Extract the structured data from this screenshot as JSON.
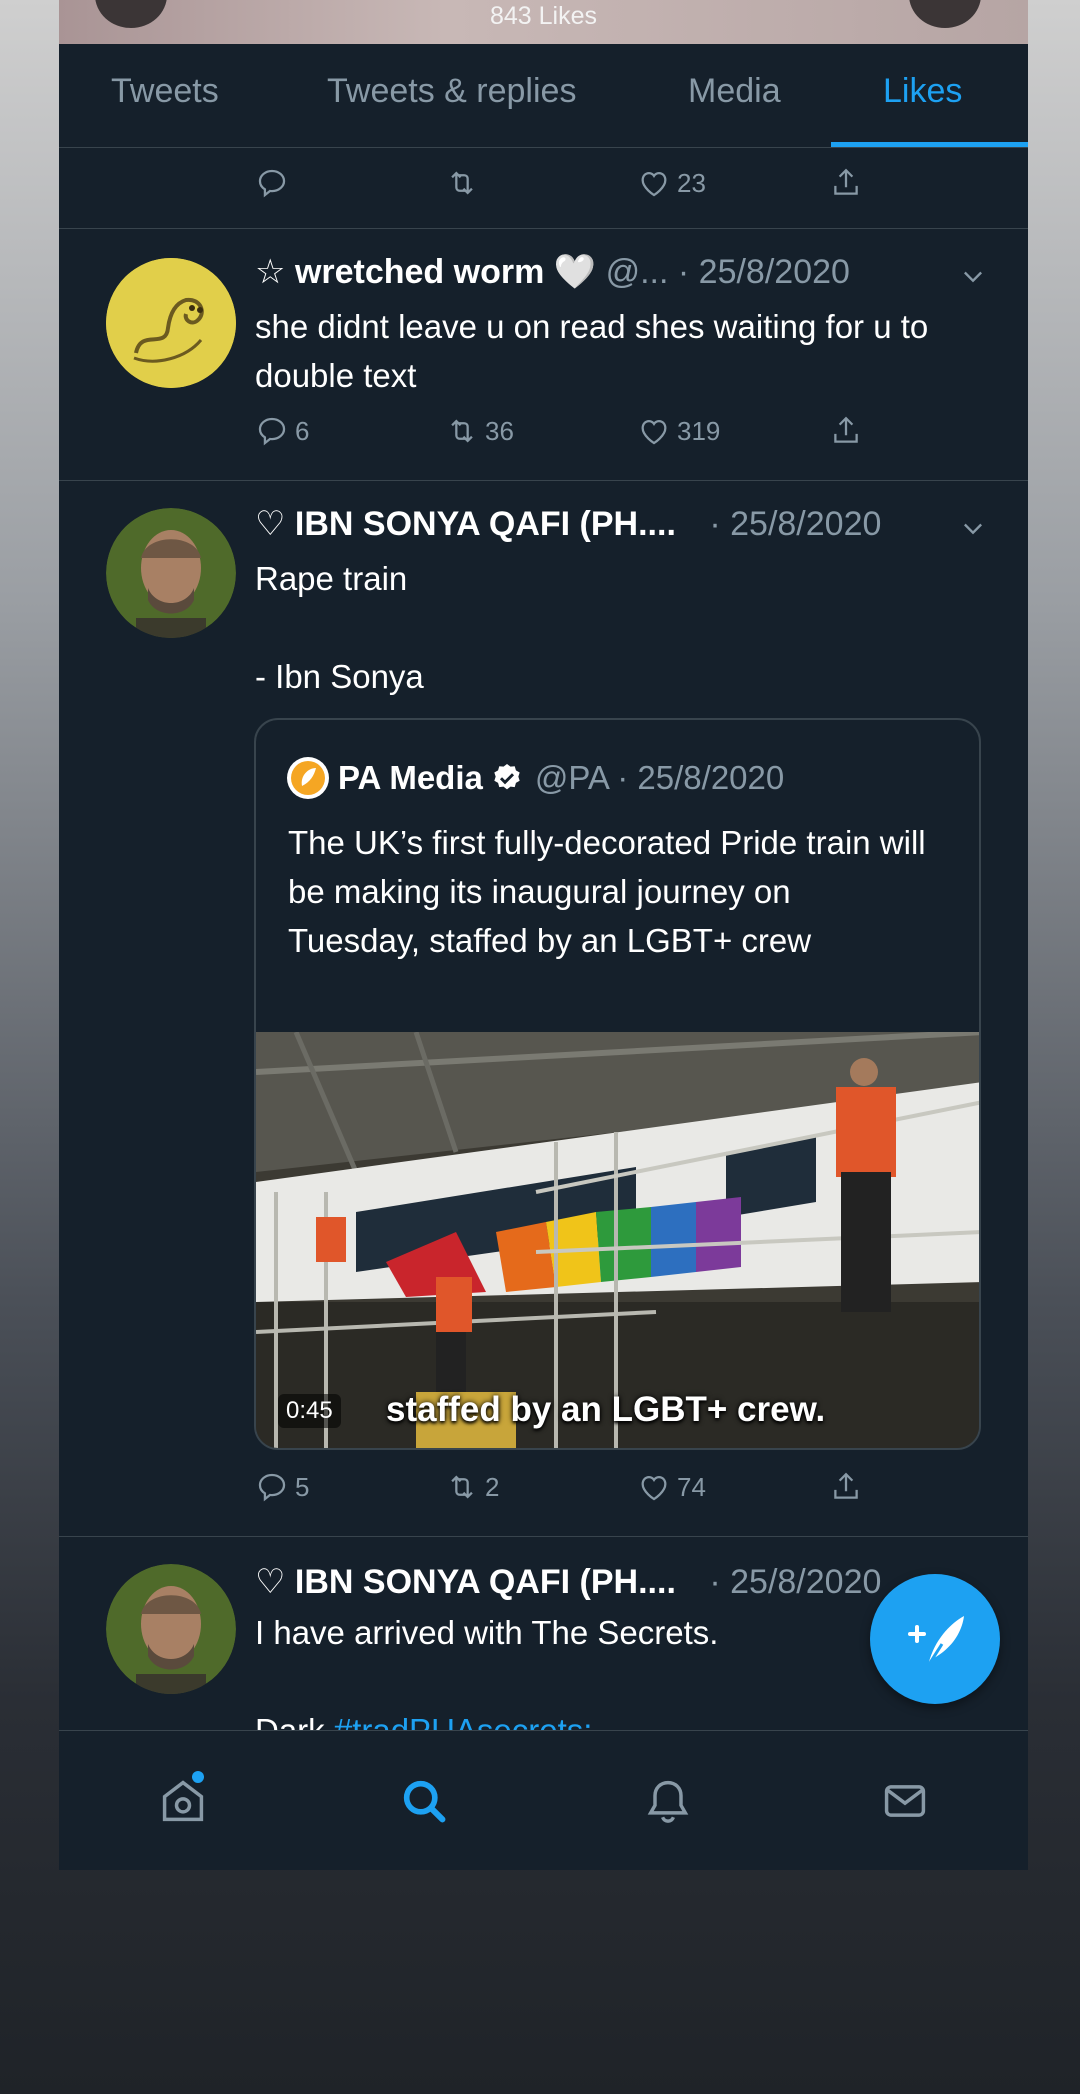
{
  "header": {
    "likes_count": "843 Likes"
  },
  "tabs": [
    {
      "label": "Tweets",
      "active": false
    },
    {
      "label": "Tweets & replies",
      "active": false
    },
    {
      "label": "Media",
      "active": false
    },
    {
      "label": "Likes",
      "active": true
    }
  ],
  "tweets": [
    {
      "actions": {
        "reply": "",
        "retweet": "",
        "like": "23",
        "share": ""
      }
    },
    {
      "star": "☆",
      "name": "wretched worm",
      "emoji": "🤍",
      "handle": "@...",
      "date": "· 25/8/2020",
      "text": "she didnt leave u on read shes waiting for u to double text",
      "actions": {
        "reply": "6",
        "retweet": "36",
        "like": "319",
        "share": ""
      }
    },
    {
      "name": "♡ IBN SONYA QAFI (PH....",
      "date": "· 25/8/2020",
      "text_line1": "Rape train",
      "text_line2": "- Ibn Sonya",
      "quote": {
        "name": "PA Media",
        "handle": "@PA · 25/8/2020",
        "text": "The UK’s first fully-decorated Pride train will be making its inaugural journey on Tuesday, staffed by an LGBT+ crew",
        "video_time": "0:45",
        "caption": "staffed by an LGBT+ crew."
      },
      "actions": {
        "reply": "5",
        "retweet": "2",
        "like": "74",
        "share": ""
      }
    },
    {
      "name": "♡ IBN SONYA QAFI (PH....",
      "date": "· 25/8/2020",
      "text": "I have arrived with The Secrets.",
      "peek_prefix": "Dark ",
      "peek_hashtag": "#tradPUAsecrets:"
    }
  ],
  "colors": {
    "accent": "#1da1f2",
    "background": "#15202b",
    "muted": "#8899a6",
    "border": "#38444d"
  },
  "icons": [
    "reply-icon",
    "retweet-icon",
    "like-icon",
    "share-icon",
    "home-icon",
    "search-icon",
    "notifications-icon",
    "messages-icon",
    "compose-tweet-icon"
  ]
}
